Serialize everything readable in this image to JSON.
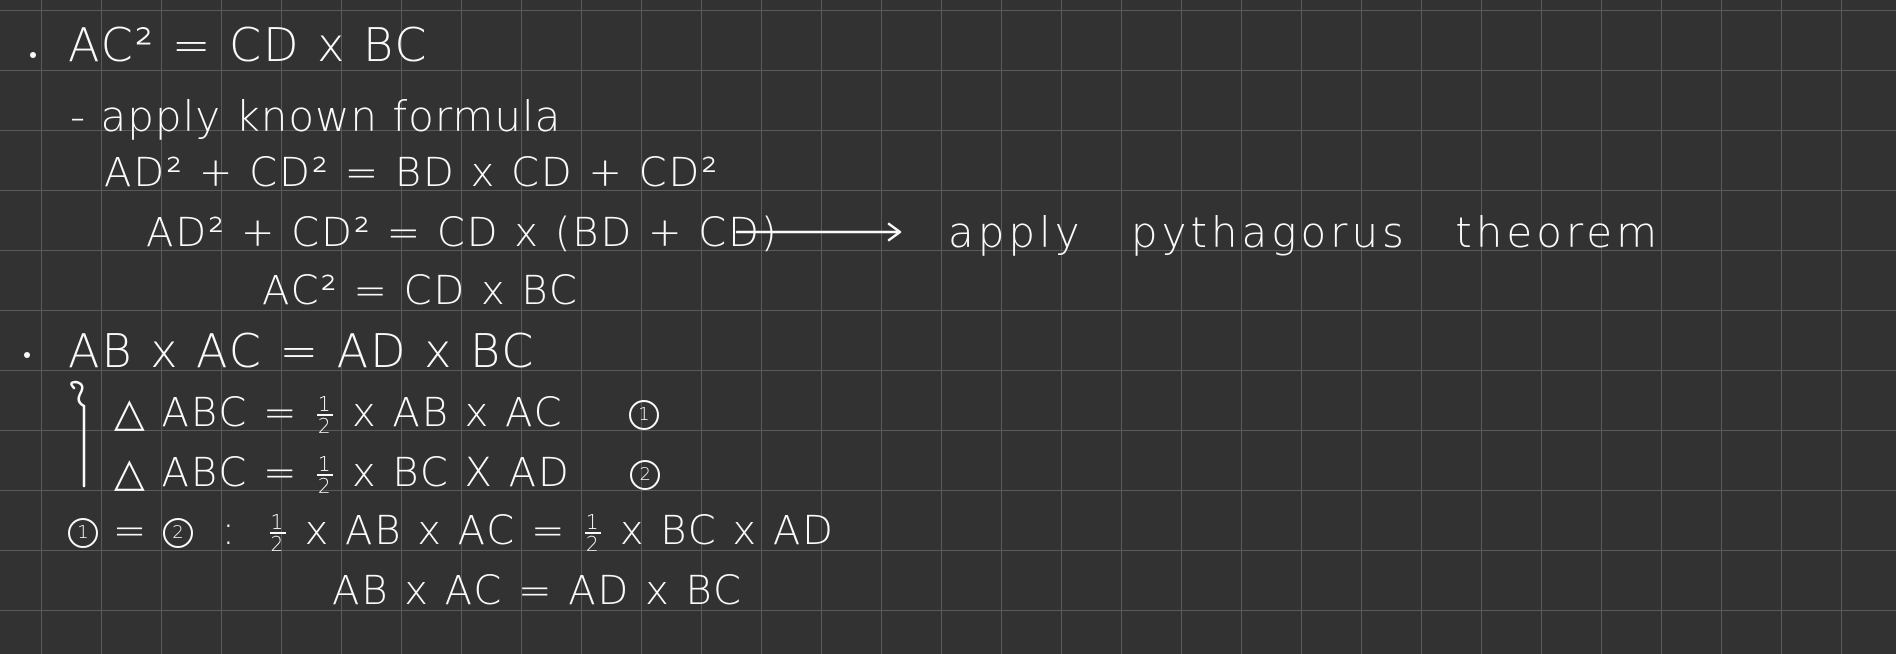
{
  "notes": {
    "section1": {
      "claim": "AC² = CD x BC",
      "step_label": "- apply known formula",
      "line1": "AD² + CD² = BD x CD + CD²",
      "line2": "AD² + CD² = CD x (BD + CD)",
      "annotation": "apply pythagorus theorem",
      "line3": "AC² = CD x BC"
    },
    "section2": {
      "claim": "AB x AC = AD x BC",
      "area1": {
        "lhs": "△ ABC =",
        "num": "1",
        "den": "2",
        "rhs": "x AB x AC",
        "marker": "1"
      },
      "area2": {
        "lhs": "△ ABC =",
        "num": "1",
        "den": "2",
        "rhs": "x BC X AD",
        "marker": "2"
      },
      "equate": {
        "m1": "1",
        "eq": "=",
        "m2": "2",
        "colon": ":",
        "left_num": "1",
        "left_den": "2",
        "left_rhs": "x AB x AC =",
        "right_num": "1",
        "right_den": "2",
        "right_rhs": "x BC x AD"
      },
      "result": "AB x AC = AD x BC"
    }
  }
}
